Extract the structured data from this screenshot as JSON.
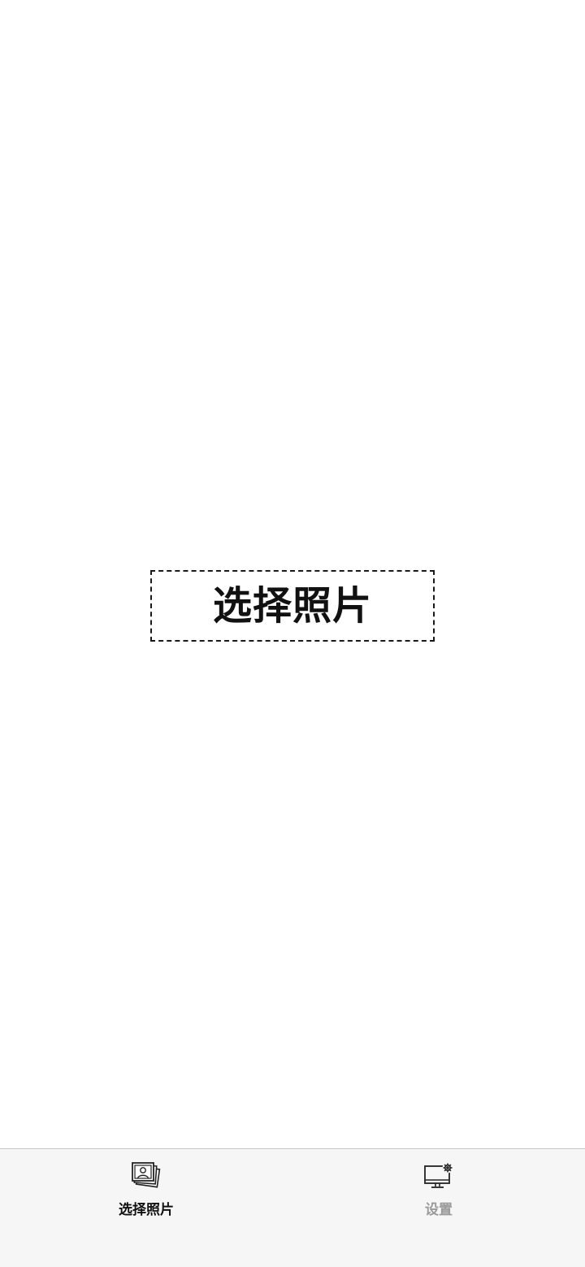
{
  "main": {
    "select_button_label": "选择照片"
  },
  "tabbar": {
    "tabs": [
      {
        "label": "选择照片",
        "icon": "photos-icon",
        "active": true
      },
      {
        "label": "设置",
        "icon": "monitor-settings-icon",
        "active": false
      }
    ]
  },
  "colors": {
    "background": "#ffffff",
    "tabbar_background": "#f6f6f6",
    "active_text": "#111111",
    "inactive_text": "#9a9a9a",
    "border": "#1a1a1a"
  }
}
